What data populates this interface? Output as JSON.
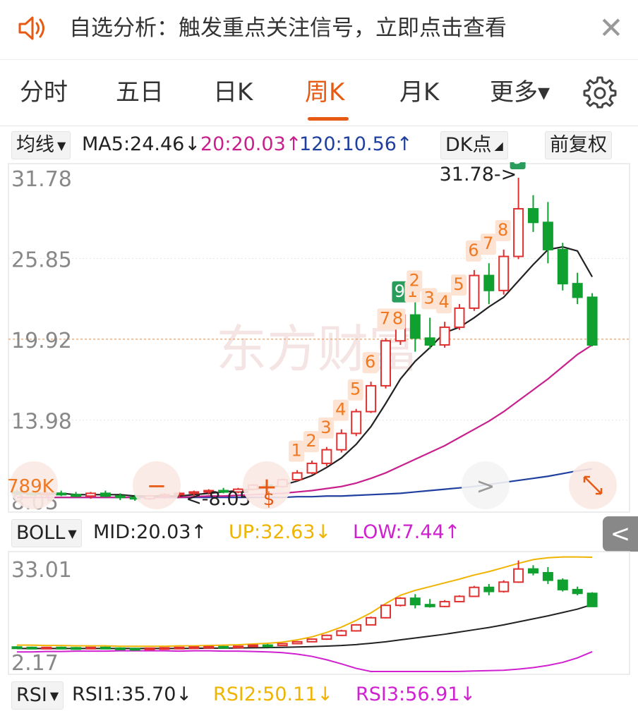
{
  "banner": {
    "text": "自选分析：触发重点关注信号，立即点击查看",
    "close_label": "✕"
  },
  "tabs": [
    {
      "label": "分时"
    },
    {
      "label": "五日"
    },
    {
      "label": "日K"
    },
    {
      "label": "周K",
      "active": true
    },
    {
      "label": "月K"
    },
    {
      "label": "更多▾"
    }
  ],
  "ma_bar": {
    "selector": "均线",
    "ma5": "MA5:24.46↓",
    "ma20": "20:20.03↑",
    "ma120": "120:10.56↑",
    "dk_label": "DK点",
    "adjust_label": "前复权"
  },
  "main_chart": {
    "y_labels": [
      "31.78",
      "25.85",
      "19.92",
      "13.98",
      "8.05"
    ],
    "high_annotation": "31.78->",
    "low_annotation": "<-8.05",
    "watermark": "东方财富",
    "controls": {
      "zoom_out": "−",
      "zoom_in": "+",
      "next": ">",
      "dollar": "$",
      "seq_label": "789K"
    }
  },
  "boll_bar": {
    "selector": "BOLL",
    "mid": "MID:20.03↑",
    "up": "UP:32.63↓",
    "low": "LOW:7.44↑",
    "side_tab": "<"
  },
  "boll_chart": {
    "y_labels": [
      "33.01",
      "2.17"
    ]
  },
  "rsi_bar": {
    "selector": "RSI",
    "rsi1": "RSI1:35.70↓",
    "rsi2": "RSI2:50.11↓",
    "rsi3": "RSI3:56.91↓"
  },
  "colors": {
    "up": "#e03030",
    "down": "#10a030",
    "accent": "#e65a14",
    "ma5": "#222222",
    "ma20": "#c8208c",
    "ma120": "#2040a0",
    "boll_up": "#f0b400",
    "boll_low": "#d020d0",
    "seq_orange": "#f07820",
    "seq_green": "#2a9d5c"
  },
  "chart_data": {
    "type": "candlestick",
    "period": "weekly",
    "ylim": [
      8.05,
      31.78
    ],
    "candles": [
      {
        "o": 8.7,
        "h": 8.9,
        "l": 8.5,
        "c": 8.6
      },
      {
        "o": 8.6,
        "h": 8.8,
        "l": 8.4,
        "c": 8.5
      },
      {
        "o": 8.5,
        "h": 8.7,
        "l": 8.3,
        "c": 8.6
      },
      {
        "o": 8.6,
        "h": 8.8,
        "l": 8.4,
        "c": 8.5
      },
      {
        "o": 8.5,
        "h": 8.7,
        "l": 8.3,
        "c": 8.4
      },
      {
        "o": 8.4,
        "h": 8.7,
        "l": 8.2,
        "c": 8.6
      },
      {
        "o": 8.6,
        "h": 8.8,
        "l": 8.3,
        "c": 8.4
      },
      {
        "o": 8.4,
        "h": 8.6,
        "l": 8.1,
        "c": 8.3
      },
      {
        "o": 8.3,
        "h": 8.5,
        "l": 8.05,
        "c": 8.2
      },
      {
        "o": 8.2,
        "h": 8.5,
        "l": 8.1,
        "c": 8.4
      },
      {
        "o": 8.4,
        "h": 8.6,
        "l": 8.2,
        "c": 8.5
      },
      {
        "o": 8.5,
        "h": 8.7,
        "l": 8.3,
        "c": 8.6
      },
      {
        "o": 8.6,
        "h": 8.8,
        "l": 8.4,
        "c": 8.7
      },
      {
        "o": 8.7,
        "h": 8.9,
        "l": 8.5,
        "c": 8.8
      },
      {
        "o": 8.8,
        "h": 9.0,
        "l": 8.6,
        "c": 8.7
      },
      {
        "o": 8.7,
        "h": 9.0,
        "l": 8.6,
        "c": 8.9
      },
      {
        "o": 8.9,
        "h": 9.3,
        "l": 8.8,
        "c": 9.2
      },
      {
        "o": 9.2,
        "h": 9.5,
        "l": 9.0,
        "c": 9.1
      },
      {
        "o": 9.1,
        "h": 9.7,
        "l": 9.0,
        "c": 9.6
      },
      {
        "o": 9.6,
        "h": 10.3,
        "l": 9.5,
        "c": 10.1
      },
      {
        "o": 10.1,
        "h": 11.0,
        "l": 10.0,
        "c": 10.8
      },
      {
        "o": 10.8,
        "h": 12.0,
        "l": 10.6,
        "c": 11.8
      },
      {
        "o": 11.8,
        "h": 13.3,
        "l": 11.6,
        "c": 13.0
      },
      {
        "o": 13.0,
        "h": 14.8,
        "l": 12.8,
        "c": 14.6
      },
      {
        "o": 14.6,
        "h": 16.8,
        "l": 14.5,
        "c": 16.5
      },
      {
        "o": 16.5,
        "h": 20.0,
        "l": 16.3,
        "c": 19.8
      },
      {
        "o": 19.8,
        "h": 22.0,
        "l": 19.5,
        "c": 21.7
      },
      {
        "o": 21.7,
        "h": 22.8,
        "l": 19.0,
        "c": 20.0
      },
      {
        "o": 20.0,
        "h": 21.5,
        "l": 19.2,
        "c": 19.5
      },
      {
        "o": 19.5,
        "h": 21.2,
        "l": 19.3,
        "c": 20.8
      },
      {
        "o": 20.8,
        "h": 22.5,
        "l": 20.6,
        "c": 22.2
      },
      {
        "o": 22.2,
        "h": 25.0,
        "l": 22.0,
        "c": 24.6
      },
      {
        "o": 24.6,
        "h": 25.5,
        "l": 22.5,
        "c": 23.5
      },
      {
        "o": 23.5,
        "h": 26.5,
        "l": 23.2,
        "c": 26.0
      },
      {
        "o": 26.0,
        "h": 31.78,
        "l": 25.8,
        "c": 29.5
      },
      {
        "o": 29.5,
        "h": 30.5,
        "l": 27.8,
        "c": 28.5
      },
      {
        "o": 28.5,
        "h": 30.0,
        "l": 25.5,
        "c": 26.5
      },
      {
        "o": 26.5,
        "h": 27.0,
        "l": 23.5,
        "c": 24.0
      },
      {
        "o": 24.0,
        "h": 24.8,
        "l": 22.5,
        "c": 23.0
      },
      {
        "o": 23.0,
        "h": 23.3,
        "l": 19.4,
        "c": 19.5
      }
    ],
    "ma5": [
      8.6,
      8.6,
      8.6,
      8.6,
      8.5,
      8.5,
      8.5,
      8.5,
      8.4,
      8.4,
      8.4,
      8.4,
      8.5,
      8.6,
      8.7,
      8.8,
      8.9,
      9.0,
      9.2,
      9.5,
      9.9,
      10.5,
      11.2,
      12.2,
      13.5,
      15.2,
      17.0,
      18.3,
      19.3,
      20.4,
      20.8,
      21.5,
      22.3,
      23.0,
      24.2,
      25.4,
      26.5,
      26.7,
      26.4,
      24.5
    ],
    "ma20": [
      8.3,
      8.3,
      8.3,
      8.3,
      8.3,
      8.3,
      8.3,
      8.3,
      8.3,
      8.3,
      8.3,
      8.3,
      8.35,
      8.4,
      8.4,
      8.45,
      8.5,
      8.55,
      8.6,
      8.7,
      8.8,
      8.95,
      9.1,
      9.35,
      9.7,
      10.1,
      10.6,
      11.1,
      11.6,
      12.1,
      12.7,
      13.3,
      13.9,
      14.6,
      15.4,
      16.2,
      17.0,
      17.9,
      18.8,
      19.5
    ],
    "ma120": [
      8.3,
      8.3,
      8.3,
      8.3,
      8.3,
      8.3,
      8.3,
      8.3,
      8.3,
      8.3,
      8.3,
      8.3,
      8.3,
      8.3,
      8.3,
      8.3,
      8.3,
      8.3,
      8.3,
      8.35,
      8.35,
      8.4,
      8.4,
      8.45,
      8.5,
      8.55,
      8.6,
      8.7,
      8.8,
      8.9,
      9.0,
      9.1,
      9.25,
      9.4,
      9.55,
      9.7,
      9.85,
      10.05,
      10.25,
      10.4
    ],
    "seq_labels": [
      {
        "i": 19,
        "t": "1",
        "c": "orange"
      },
      {
        "i": 20,
        "t": "2",
        "c": "orange"
      },
      {
        "i": 21,
        "t": "3",
        "c": "orange"
      },
      {
        "i": 22,
        "t": "4",
        "c": "orange"
      },
      {
        "i": 23,
        "t": "5",
        "c": "orange"
      },
      {
        "i": 24,
        "t": "6",
        "c": "orange"
      },
      {
        "i": 25,
        "t": "7",
        "c": "orange"
      },
      {
        "i": 25,
        "t": "8",
        "c": "orange"
      },
      {
        "i": 26,
        "t": "9",
        "c": "green"
      },
      {
        "i": 26,
        "t": "1",
        "c": "orange"
      },
      {
        "i": 27,
        "t": "2",
        "c": "orange"
      },
      {
        "i": 28,
        "t": "3",
        "c": "orange"
      },
      {
        "i": 29,
        "t": "4",
        "c": "orange"
      },
      {
        "i": 30,
        "t": "5",
        "c": "orange"
      },
      {
        "i": 31,
        "t": "6",
        "c": "orange"
      },
      {
        "i": 32,
        "t": "7",
        "c": "orange"
      },
      {
        "i": 33,
        "t": "8",
        "c": "orange"
      },
      {
        "i": 34,
        "t": "9",
        "c": "green"
      }
    ],
    "boll": {
      "ylim": [
        2.17,
        33.01
      ],
      "up": [
        9.2,
        9.2,
        9.1,
        9.1,
        9.0,
        9.0,
        9.0,
        8.9,
        8.9,
        8.9,
        8.9,
        9.0,
        9.0,
        9.1,
        9.2,
        9.3,
        9.5,
        9.7,
        10.0,
        10.6,
        11.4,
        12.6,
        14.0,
        15.8,
        17.8,
        20.3,
        22.5,
        23.8,
        24.8,
        25.8,
        26.8,
        27.9,
        28.8,
        29.9,
        31.0,
        32.0,
        32.5,
        32.7,
        32.7,
        32.63
      ],
      "mid": [
        8.3,
        8.3,
        8.3,
        8.3,
        8.3,
        8.3,
        8.3,
        8.3,
        8.3,
        8.3,
        8.3,
        8.3,
        8.35,
        8.4,
        8.4,
        8.45,
        8.5,
        8.55,
        8.6,
        8.7,
        8.8,
        8.95,
        9.1,
        9.35,
        9.7,
        10.1,
        10.6,
        11.1,
        11.6,
        12.1,
        12.7,
        13.3,
        13.9,
        14.6,
        15.4,
        16.2,
        17.0,
        17.9,
        18.8,
        20.03
      ],
      "low": [
        7.4,
        7.4,
        7.5,
        7.5,
        7.6,
        7.6,
        7.6,
        7.7,
        7.7,
        7.7,
        7.7,
        7.6,
        7.7,
        7.7,
        7.6,
        7.6,
        7.5,
        7.4,
        7.2,
        6.8,
        6.2,
        5.3,
        4.2,
        3.0,
        2.17,
        2.17,
        2.17,
        2.17,
        2.17,
        2.17,
        2.2,
        2.3,
        2.4,
        2.5,
        2.8,
        3.2,
        3.8,
        4.6,
        5.8,
        7.44
      ]
    }
  }
}
